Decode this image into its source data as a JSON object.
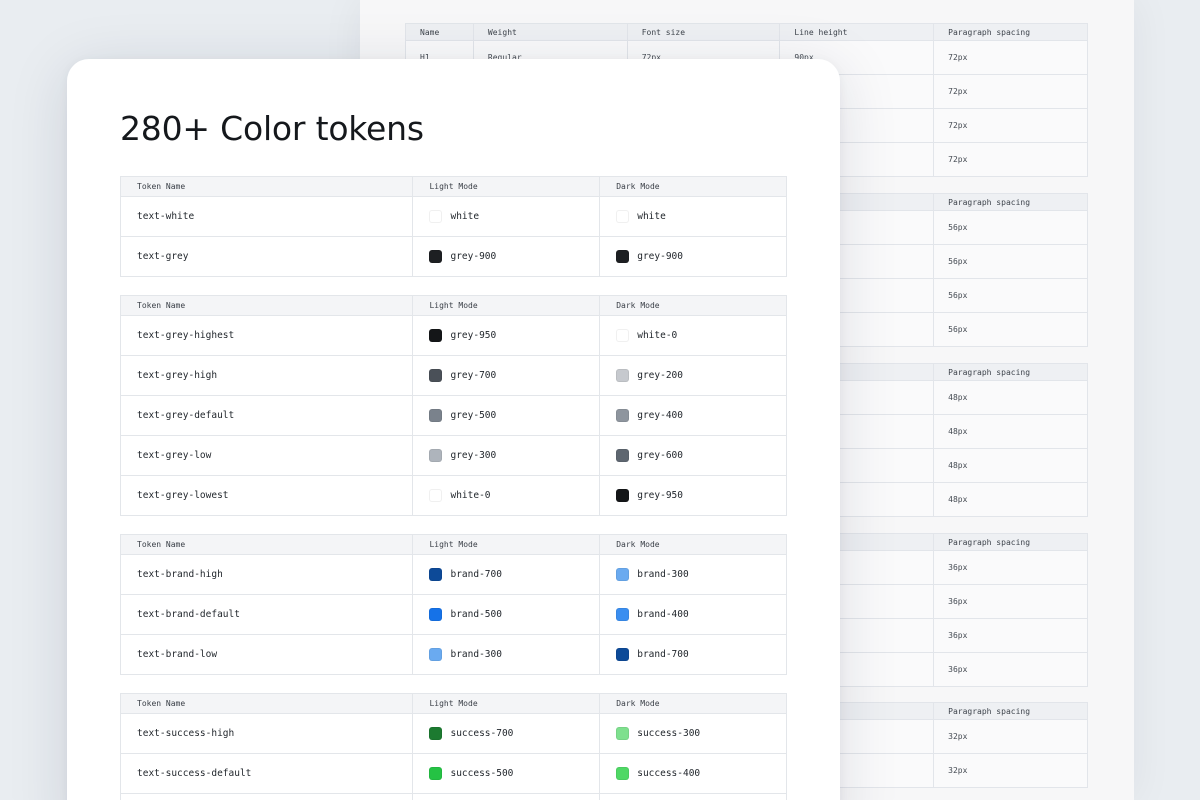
{
  "back_sheet": {
    "headers": [
      "Name",
      "Weight",
      "Font size",
      "Line height",
      "Paragraph spacing"
    ],
    "first_row": [
      "H1",
      "Regular",
      "72px",
      "90px",
      "72px"
    ],
    "spacing_header": "Paragraph spacing",
    "groups": [
      {
        "values": [
          "72px",
          "72px",
          "72px",
          "72px"
        ]
      },
      {
        "values": [
          "56px",
          "56px",
          "56px",
          "56px"
        ]
      },
      {
        "values": [
          "48px",
          "48px",
          "48px",
          "48px"
        ]
      },
      {
        "values": [
          "36px",
          "36px",
          "36px",
          "36px"
        ]
      },
      {
        "values": [
          "32px",
          "32px"
        ]
      }
    ]
  },
  "card": {
    "title": "280+ Color tokens",
    "headers": {
      "name": "Token Name",
      "light": "Light Mode",
      "dark": "Dark Mode"
    },
    "tables": [
      {
        "rows": [
          {
            "name": "text-white",
            "light": "white",
            "light_color": "#ffffff",
            "dark": "white",
            "dark_color": "#ffffff"
          },
          {
            "name": "text-grey",
            "light": "grey-900",
            "light_color": "#1d1f22",
            "dark": "grey-900",
            "dark_color": "#1d1f22"
          }
        ]
      },
      {
        "rows": [
          {
            "name": "text-grey-highest",
            "light": "grey-950",
            "light_color": "#141618",
            "dark": "white-0",
            "dark_color": "#ffffff"
          },
          {
            "name": "text-grey-high",
            "light": "grey-700",
            "light_color": "#4a5058",
            "dark": "grey-200",
            "dark_color": "#c6c9ce"
          },
          {
            "name": "text-grey-default",
            "light": "grey-500",
            "light_color": "#7a828c",
            "dark": "grey-400",
            "dark_color": "#8e959e"
          },
          {
            "name": "text-grey-low",
            "light": "grey-300",
            "light_color": "#aeb4bc",
            "dark": "grey-600",
            "dark_color": "#5e6670"
          },
          {
            "name": "text-grey-lowest",
            "light": "white-0",
            "light_color": "#ffffff",
            "dark": "grey-950",
            "dark_color": "#141618"
          }
        ]
      },
      {
        "rows": [
          {
            "name": "text-brand-high",
            "light": "brand-700",
            "light_color": "#0d4a98",
            "dark": "brand-300",
            "dark_color": "#6aaaf0"
          },
          {
            "name": "text-brand-default",
            "light": "brand-500",
            "light_color": "#1572e8",
            "dark": "brand-400",
            "dark_color": "#3a8ef0"
          },
          {
            "name": "text-brand-low",
            "light": "brand-300",
            "light_color": "#6aaaf0",
            "dark": "brand-700",
            "dark_color": "#0d4a98"
          }
        ]
      },
      {
        "rows": [
          {
            "name": "text-success-high",
            "light": "success-700",
            "light_color": "#1c7a30",
            "dark": "success-300",
            "dark_color": "#7ee08e"
          },
          {
            "name": "text-success-default",
            "light": "success-500",
            "light_color": "#25c244",
            "dark": "success-400",
            "dark_color": "#4fd865"
          },
          {
            "name": "",
            "light": "",
            "light_color": "#ffffff",
            "dark": "",
            "dark_color": "#ffffff"
          }
        ]
      }
    ]
  }
}
